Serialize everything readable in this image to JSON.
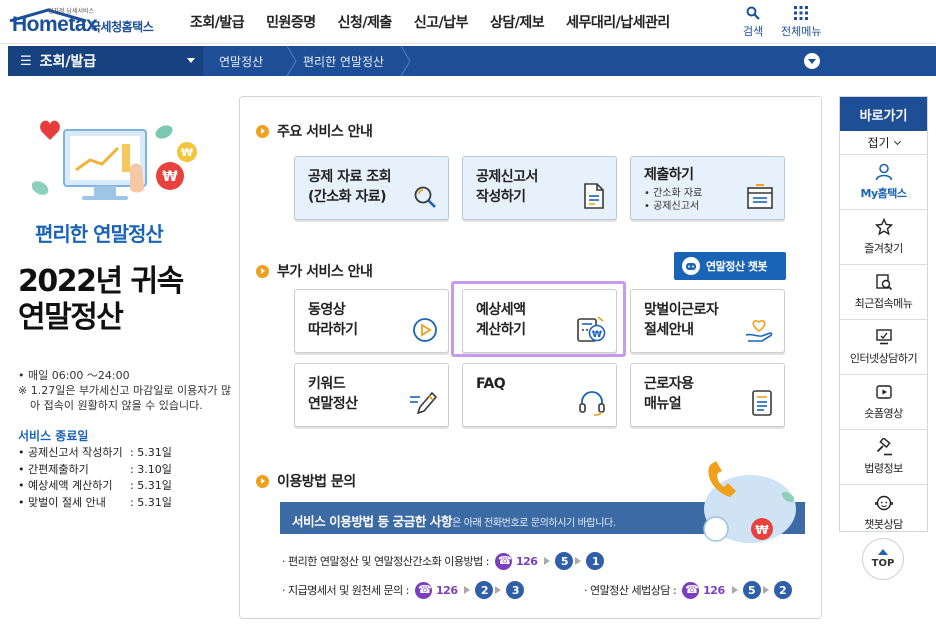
{
  "header": {
    "logo_sub": "전자적 납세서비스",
    "logo_main": "Hometax",
    "logo_kr": "국세청홈택스",
    "gnb": [
      "조회/발급",
      "민원증명",
      "신청/제출",
      "신고/납부",
      "상담/제보",
      "세무대리/납세관리"
    ],
    "search_label": "검색",
    "allmenu_label": "전체메뉴"
  },
  "navbar": {
    "current": "조회/발급",
    "crumbs": [
      "연말정산",
      "편리한 연말정산"
    ]
  },
  "left": {
    "title": "편리한 연말정산",
    "big_line1": "2022년 귀속",
    "big_line2": "연말정산",
    "hours": "• 매일 06:00 ～24:00",
    "note": "※ 1.27일은 부가세신고 마감일로 이용자가 많아 접속이 원활하지 않을 수 있습니다.",
    "end_title": "서비스 종료일",
    "end_list": [
      {
        "k": "• 공제신고서 작성하기",
        "v": ": 5.31일"
      },
      {
        "k": "• 간편제출하기",
        "v": ": 3.10일"
      },
      {
        "k": "• 예상세액 계산하기",
        "v": ": 5.31일"
      },
      {
        "k": "• 맞벌이 절세 안내",
        "v": ": 5.31일"
      }
    ]
  },
  "main": {
    "sec1": "주요 서비스 안내",
    "sec2": "부가 서비스 안내",
    "sec3": "이용방법 문의",
    "chatbot": "연말정산 챗봇",
    "cards1": [
      {
        "label": "공제 자료 조회\n(간소화 자료)",
        "icon": "search-doc-icon"
      },
      {
        "label": "공제신고서\n작성하기",
        "icon": "document-edit-icon"
      },
      {
        "label": "제출하기",
        "icon": "submit-tray-icon",
        "bullets": [
          "• 간소화 자료",
          "• 공제신고서"
        ]
      }
    ],
    "cards2": [
      {
        "label": "동영상\n따라하기",
        "icon": "play-icon"
      },
      {
        "label": "예상세액\n계산하기",
        "icon": "calculator-won-icon"
      },
      {
        "label": "맞벌이근로자\n절세안내",
        "icon": "heart-hand-icon"
      },
      {
        "label": "키워드\n연말정산",
        "icon": "pencil-icon"
      },
      {
        "label": "FAQ",
        "icon": "headset-icon"
      },
      {
        "label": "근로자용\n매뉴얼",
        "icon": "manual-icon"
      }
    ],
    "banner_bold": "서비스 이용방법 등 궁금한 사항",
    "banner_rest": "은 아래 전화번호로 문의하시기 바랍니다.",
    "contact1_label": "· 편리한 연말정산 및 연말정산간소화 이용방법 :",
    "contact1_num": "126",
    "contact1_steps": [
      "5",
      "1"
    ],
    "contact2_label": "· 지급명세서 및 원천세 문의 :",
    "contact2_num": "126",
    "contact2_steps": [
      "2",
      "3"
    ],
    "contact3_label": "· 연말정산 세법상담 :",
    "contact3_num": "126",
    "contact3_steps": [
      "5",
      "2"
    ]
  },
  "quick": {
    "title": "바로가기",
    "fold": "접기",
    "items": [
      "My홈택스",
      "즐겨찾기",
      "최근접속메뉴",
      "인터넷상담하기",
      "숏폼영상",
      "법령정보",
      "챗봇상담"
    ],
    "top": "TOP"
  },
  "colors": {
    "brand_blue": "#1e4f96",
    "accent_orange": "#f0a01a",
    "highlight_purple": "#c79af0",
    "phone_purple": "#7a3fbf"
  }
}
